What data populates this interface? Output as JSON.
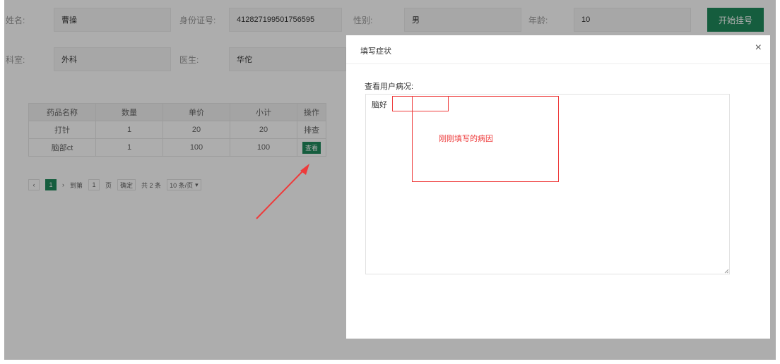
{
  "patient": {
    "name_label": "姓名:",
    "name_value": "曹操",
    "id_label": "身份证号:",
    "id_value": "412827199501756595",
    "gender_label": "性别:",
    "gender_value": "男",
    "age_label": "年龄:",
    "age_value": "10",
    "dept_label": "科室:",
    "dept_value": "外科",
    "doctor_label": "医生:",
    "doctor_value": "华佗"
  },
  "start_button": "开始挂号",
  "table": {
    "headers": [
      "药品名称",
      "数量",
      "单价",
      "小计",
      "操作"
    ],
    "rows": [
      [
        "打针",
        "1",
        "20",
        "20",
        "排查"
      ],
      [
        "脑部ct",
        "1",
        "100",
        "100",
        "查看"
      ]
    ]
  },
  "pager": {
    "prev": "‹",
    "current_page": "1",
    "next": "›",
    "goto_label": "到第",
    "goto_value": "1",
    "page_unit": "页",
    "confirm": "确定",
    "total": "共 2 条",
    "page_size": "10 条/页"
  },
  "modal": {
    "title": "填写症状",
    "close": "×",
    "field_label": "查看用户病况:",
    "textarea_value": "脑好",
    "annotation": "刚刚填写的病因"
  },
  "colors": {
    "accent": "#1f8a5c",
    "annotation": "#ee3b3b",
    "overlay": "rgba(0,0,0,0.32)"
  }
}
